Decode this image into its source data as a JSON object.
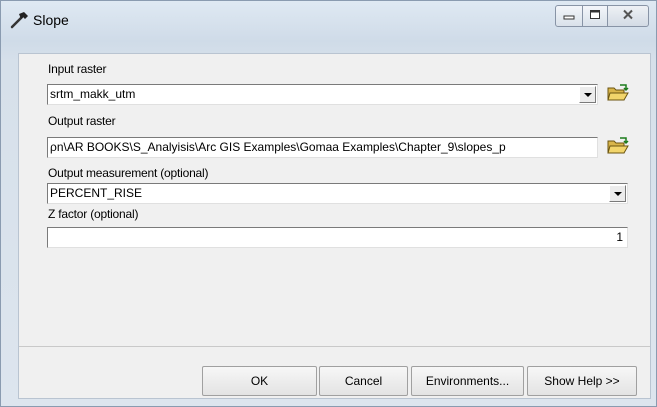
{
  "window": {
    "title": "Slope",
    "icon": "hammer-icon",
    "controls": {
      "minimize": "minimize-icon",
      "maximize": "maximize-icon",
      "close": "close-icon"
    }
  },
  "form": {
    "input_raster": {
      "label": "Input raster",
      "value": "srtm_makk_utm"
    },
    "output_raster": {
      "label": "Output raster",
      "value": "ρn\\AR BOOKS\\S_Analyisis\\Arc GIS Examples\\Gomaa Examples\\Chapter_9\\slopes_p"
    },
    "output_measurement": {
      "label": "Output measurement (optional)",
      "value": "PERCENT_RISE"
    },
    "z_factor": {
      "label": "Z factor (optional)",
      "value": "1"
    }
  },
  "buttons": {
    "ok": "OK",
    "cancel": "Cancel",
    "environments": "Environments...",
    "show_help": "Show Help >>"
  }
}
